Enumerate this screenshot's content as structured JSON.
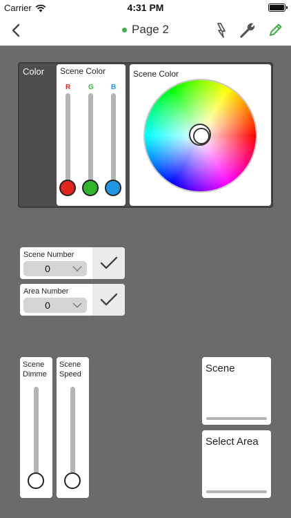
{
  "status_bar": {
    "carrier": "Carrier",
    "time": "4:31 PM"
  },
  "nav": {
    "title": "Page 2",
    "status_color": "#3cb043",
    "accent_color": "#3cb043"
  },
  "color_group": {
    "label": "Color",
    "rgb_panel": {
      "title": "Scene Color",
      "sliders": [
        {
          "letter": "R",
          "color": "#e0251e",
          "value": 0
        },
        {
          "letter": "G",
          "color": "#2fb52b",
          "value": 0
        },
        {
          "letter": "B",
          "color": "#2196e8",
          "value": 0
        }
      ]
    },
    "wheel_panel": {
      "title": "Scene Color"
    }
  },
  "scene_number": {
    "label": "Scene Number",
    "value": "0"
  },
  "area_number": {
    "label": "Area Number",
    "value": "0"
  },
  "scene_dimmer": {
    "label_line1": "Scene",
    "label_line2": "Dimme",
    "value": 0
  },
  "scene_speed": {
    "label_line1": "Scene",
    "label_line2": "Speed",
    "value": 0
  },
  "scene_button": {
    "label": "Scene"
  },
  "select_area_button": {
    "label": "Select Area"
  },
  "icons": [
    "wifi-icon",
    "battery-icon",
    "chevron-left-icon",
    "lightning-icon",
    "wrench-icon",
    "pencil-icon",
    "chevron-down-icon",
    "checkmark-icon"
  ]
}
